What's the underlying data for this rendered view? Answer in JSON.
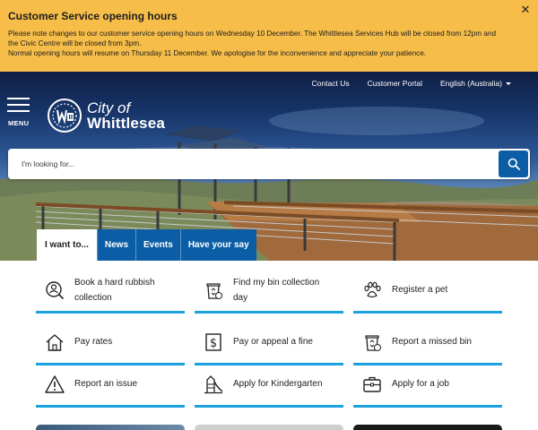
{
  "alert": {
    "title": "Customer Service opening hours",
    "line1": "Please note changes to our customer service opening hours on Wednesday 10 December. The Whittlesea Services Hub will be closed from 12pm and the Civic Centre will be closed from 3pm.",
    "line2": "Normal opening hours will resume on Thursday 11 December. We apologise for the inconvenience and appreciate your patience.",
    "close_glyph": "✕"
  },
  "topnav": {
    "contact": "Contact Us",
    "portal": "Customer Portal",
    "language": "English (Australia)"
  },
  "menu_label": "MENU",
  "logo": {
    "line1": "City of",
    "line2": "Whittlesea"
  },
  "search": {
    "placeholder": "I'm looking for..."
  },
  "tabs": [
    {
      "label": "I want to..."
    },
    {
      "label": "News"
    },
    {
      "label": "Events"
    },
    {
      "label": "Have your say"
    }
  ],
  "quick_links": [
    {
      "label": "Book a hard rubbish collection",
      "icon": "person-search-icon"
    },
    {
      "label": "Find my bin collection day",
      "icon": "recycle-bin-icon"
    },
    {
      "label": "Register a pet",
      "icon": "paw-icon"
    },
    {
      "label": "Pay rates",
      "icon": "house-icon"
    },
    {
      "label": "Pay or appeal a fine",
      "icon": "dollar-icon"
    },
    {
      "label": "Report a missed bin",
      "icon": "recycle-bin-icon"
    },
    {
      "label": "Report an issue",
      "icon": "warning-icon"
    },
    {
      "label": "Apply for Kindergarten",
      "icon": "playground-slide-icon"
    },
    {
      "label": "Apply for a job",
      "icon": "briefcase-icon"
    }
  ],
  "colors": {
    "alert_bg": "#f6bd49",
    "brand_blue": "#0b5ea5",
    "accent_cyan": "#1aa1de"
  }
}
